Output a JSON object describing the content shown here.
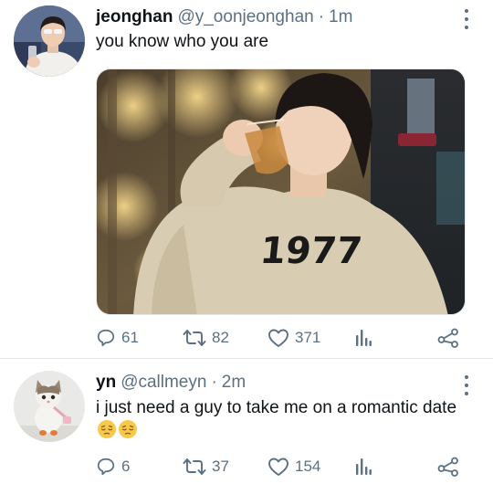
{
  "tweets": [
    {
      "name": "jeonghan",
      "handle": "@y_oonjeonghan",
      "separator": "·",
      "time": "1m",
      "text": "you know who you are",
      "media_text": "1977",
      "replies": "61",
      "retweets": "82",
      "likes": "371"
    },
    {
      "name": "yn",
      "handle": "@callmeyn",
      "separator": "·",
      "time": "2m",
      "text": "i just need a guy to take me on a romantic date",
      "replies": "6",
      "retweets": "37",
      "likes": "154"
    }
  ],
  "icons": {
    "reply": "speech-bubble-icon",
    "retweet": "retweet-arrows-icon",
    "like": "heart-outline-icon",
    "stats": "bar-chart-icon",
    "share": "share-nodes-icon",
    "more": "vertical-dots-icon",
    "emoji": "pensive-face-emoji"
  },
  "colors": {
    "text": "#0f1419",
    "secondary": "#5b7083",
    "divider": "#e6e9eb",
    "background": "#ffffff"
  }
}
